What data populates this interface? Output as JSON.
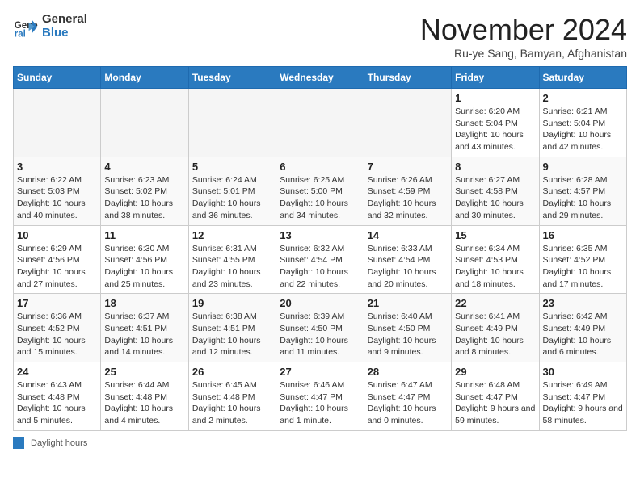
{
  "logo": {
    "general": "General",
    "blue": "Blue"
  },
  "title": "November 2024",
  "location": "Ru-ye Sang, Bamyan, Afghanistan",
  "weekdays": [
    "Sunday",
    "Monday",
    "Tuesday",
    "Wednesday",
    "Thursday",
    "Friday",
    "Saturday"
  ],
  "weeks": [
    [
      {
        "day": "",
        "info": ""
      },
      {
        "day": "",
        "info": ""
      },
      {
        "day": "",
        "info": ""
      },
      {
        "day": "",
        "info": ""
      },
      {
        "day": "",
        "info": ""
      },
      {
        "day": "1",
        "info": "Sunrise: 6:20 AM\nSunset: 5:04 PM\nDaylight: 10 hours and 43 minutes."
      },
      {
        "day": "2",
        "info": "Sunrise: 6:21 AM\nSunset: 5:04 PM\nDaylight: 10 hours and 42 minutes."
      }
    ],
    [
      {
        "day": "3",
        "info": "Sunrise: 6:22 AM\nSunset: 5:03 PM\nDaylight: 10 hours and 40 minutes."
      },
      {
        "day": "4",
        "info": "Sunrise: 6:23 AM\nSunset: 5:02 PM\nDaylight: 10 hours and 38 minutes."
      },
      {
        "day": "5",
        "info": "Sunrise: 6:24 AM\nSunset: 5:01 PM\nDaylight: 10 hours and 36 minutes."
      },
      {
        "day": "6",
        "info": "Sunrise: 6:25 AM\nSunset: 5:00 PM\nDaylight: 10 hours and 34 minutes."
      },
      {
        "day": "7",
        "info": "Sunrise: 6:26 AM\nSunset: 4:59 PM\nDaylight: 10 hours and 32 minutes."
      },
      {
        "day": "8",
        "info": "Sunrise: 6:27 AM\nSunset: 4:58 PM\nDaylight: 10 hours and 30 minutes."
      },
      {
        "day": "9",
        "info": "Sunrise: 6:28 AM\nSunset: 4:57 PM\nDaylight: 10 hours and 29 minutes."
      }
    ],
    [
      {
        "day": "10",
        "info": "Sunrise: 6:29 AM\nSunset: 4:56 PM\nDaylight: 10 hours and 27 minutes."
      },
      {
        "day": "11",
        "info": "Sunrise: 6:30 AM\nSunset: 4:56 PM\nDaylight: 10 hours and 25 minutes."
      },
      {
        "day": "12",
        "info": "Sunrise: 6:31 AM\nSunset: 4:55 PM\nDaylight: 10 hours and 23 minutes."
      },
      {
        "day": "13",
        "info": "Sunrise: 6:32 AM\nSunset: 4:54 PM\nDaylight: 10 hours and 22 minutes."
      },
      {
        "day": "14",
        "info": "Sunrise: 6:33 AM\nSunset: 4:54 PM\nDaylight: 10 hours and 20 minutes."
      },
      {
        "day": "15",
        "info": "Sunrise: 6:34 AM\nSunset: 4:53 PM\nDaylight: 10 hours and 18 minutes."
      },
      {
        "day": "16",
        "info": "Sunrise: 6:35 AM\nSunset: 4:52 PM\nDaylight: 10 hours and 17 minutes."
      }
    ],
    [
      {
        "day": "17",
        "info": "Sunrise: 6:36 AM\nSunset: 4:52 PM\nDaylight: 10 hours and 15 minutes."
      },
      {
        "day": "18",
        "info": "Sunrise: 6:37 AM\nSunset: 4:51 PM\nDaylight: 10 hours and 14 minutes."
      },
      {
        "day": "19",
        "info": "Sunrise: 6:38 AM\nSunset: 4:51 PM\nDaylight: 10 hours and 12 minutes."
      },
      {
        "day": "20",
        "info": "Sunrise: 6:39 AM\nSunset: 4:50 PM\nDaylight: 10 hours and 11 minutes."
      },
      {
        "day": "21",
        "info": "Sunrise: 6:40 AM\nSunset: 4:50 PM\nDaylight: 10 hours and 9 minutes."
      },
      {
        "day": "22",
        "info": "Sunrise: 6:41 AM\nSunset: 4:49 PM\nDaylight: 10 hours and 8 minutes."
      },
      {
        "day": "23",
        "info": "Sunrise: 6:42 AM\nSunset: 4:49 PM\nDaylight: 10 hours and 6 minutes."
      }
    ],
    [
      {
        "day": "24",
        "info": "Sunrise: 6:43 AM\nSunset: 4:48 PM\nDaylight: 10 hours and 5 minutes."
      },
      {
        "day": "25",
        "info": "Sunrise: 6:44 AM\nSunset: 4:48 PM\nDaylight: 10 hours and 4 minutes."
      },
      {
        "day": "26",
        "info": "Sunrise: 6:45 AM\nSunset: 4:48 PM\nDaylight: 10 hours and 2 minutes."
      },
      {
        "day": "27",
        "info": "Sunrise: 6:46 AM\nSunset: 4:47 PM\nDaylight: 10 hours and 1 minute."
      },
      {
        "day": "28",
        "info": "Sunrise: 6:47 AM\nSunset: 4:47 PM\nDaylight: 10 hours and 0 minutes."
      },
      {
        "day": "29",
        "info": "Sunrise: 6:48 AM\nSunset: 4:47 PM\nDaylight: 9 hours and 59 minutes."
      },
      {
        "day": "30",
        "info": "Sunrise: 6:49 AM\nSunset: 4:47 PM\nDaylight: 9 hours and 58 minutes."
      }
    ]
  ],
  "footer": {
    "icon_label": "daylight-icon",
    "label": "Daylight hours"
  }
}
